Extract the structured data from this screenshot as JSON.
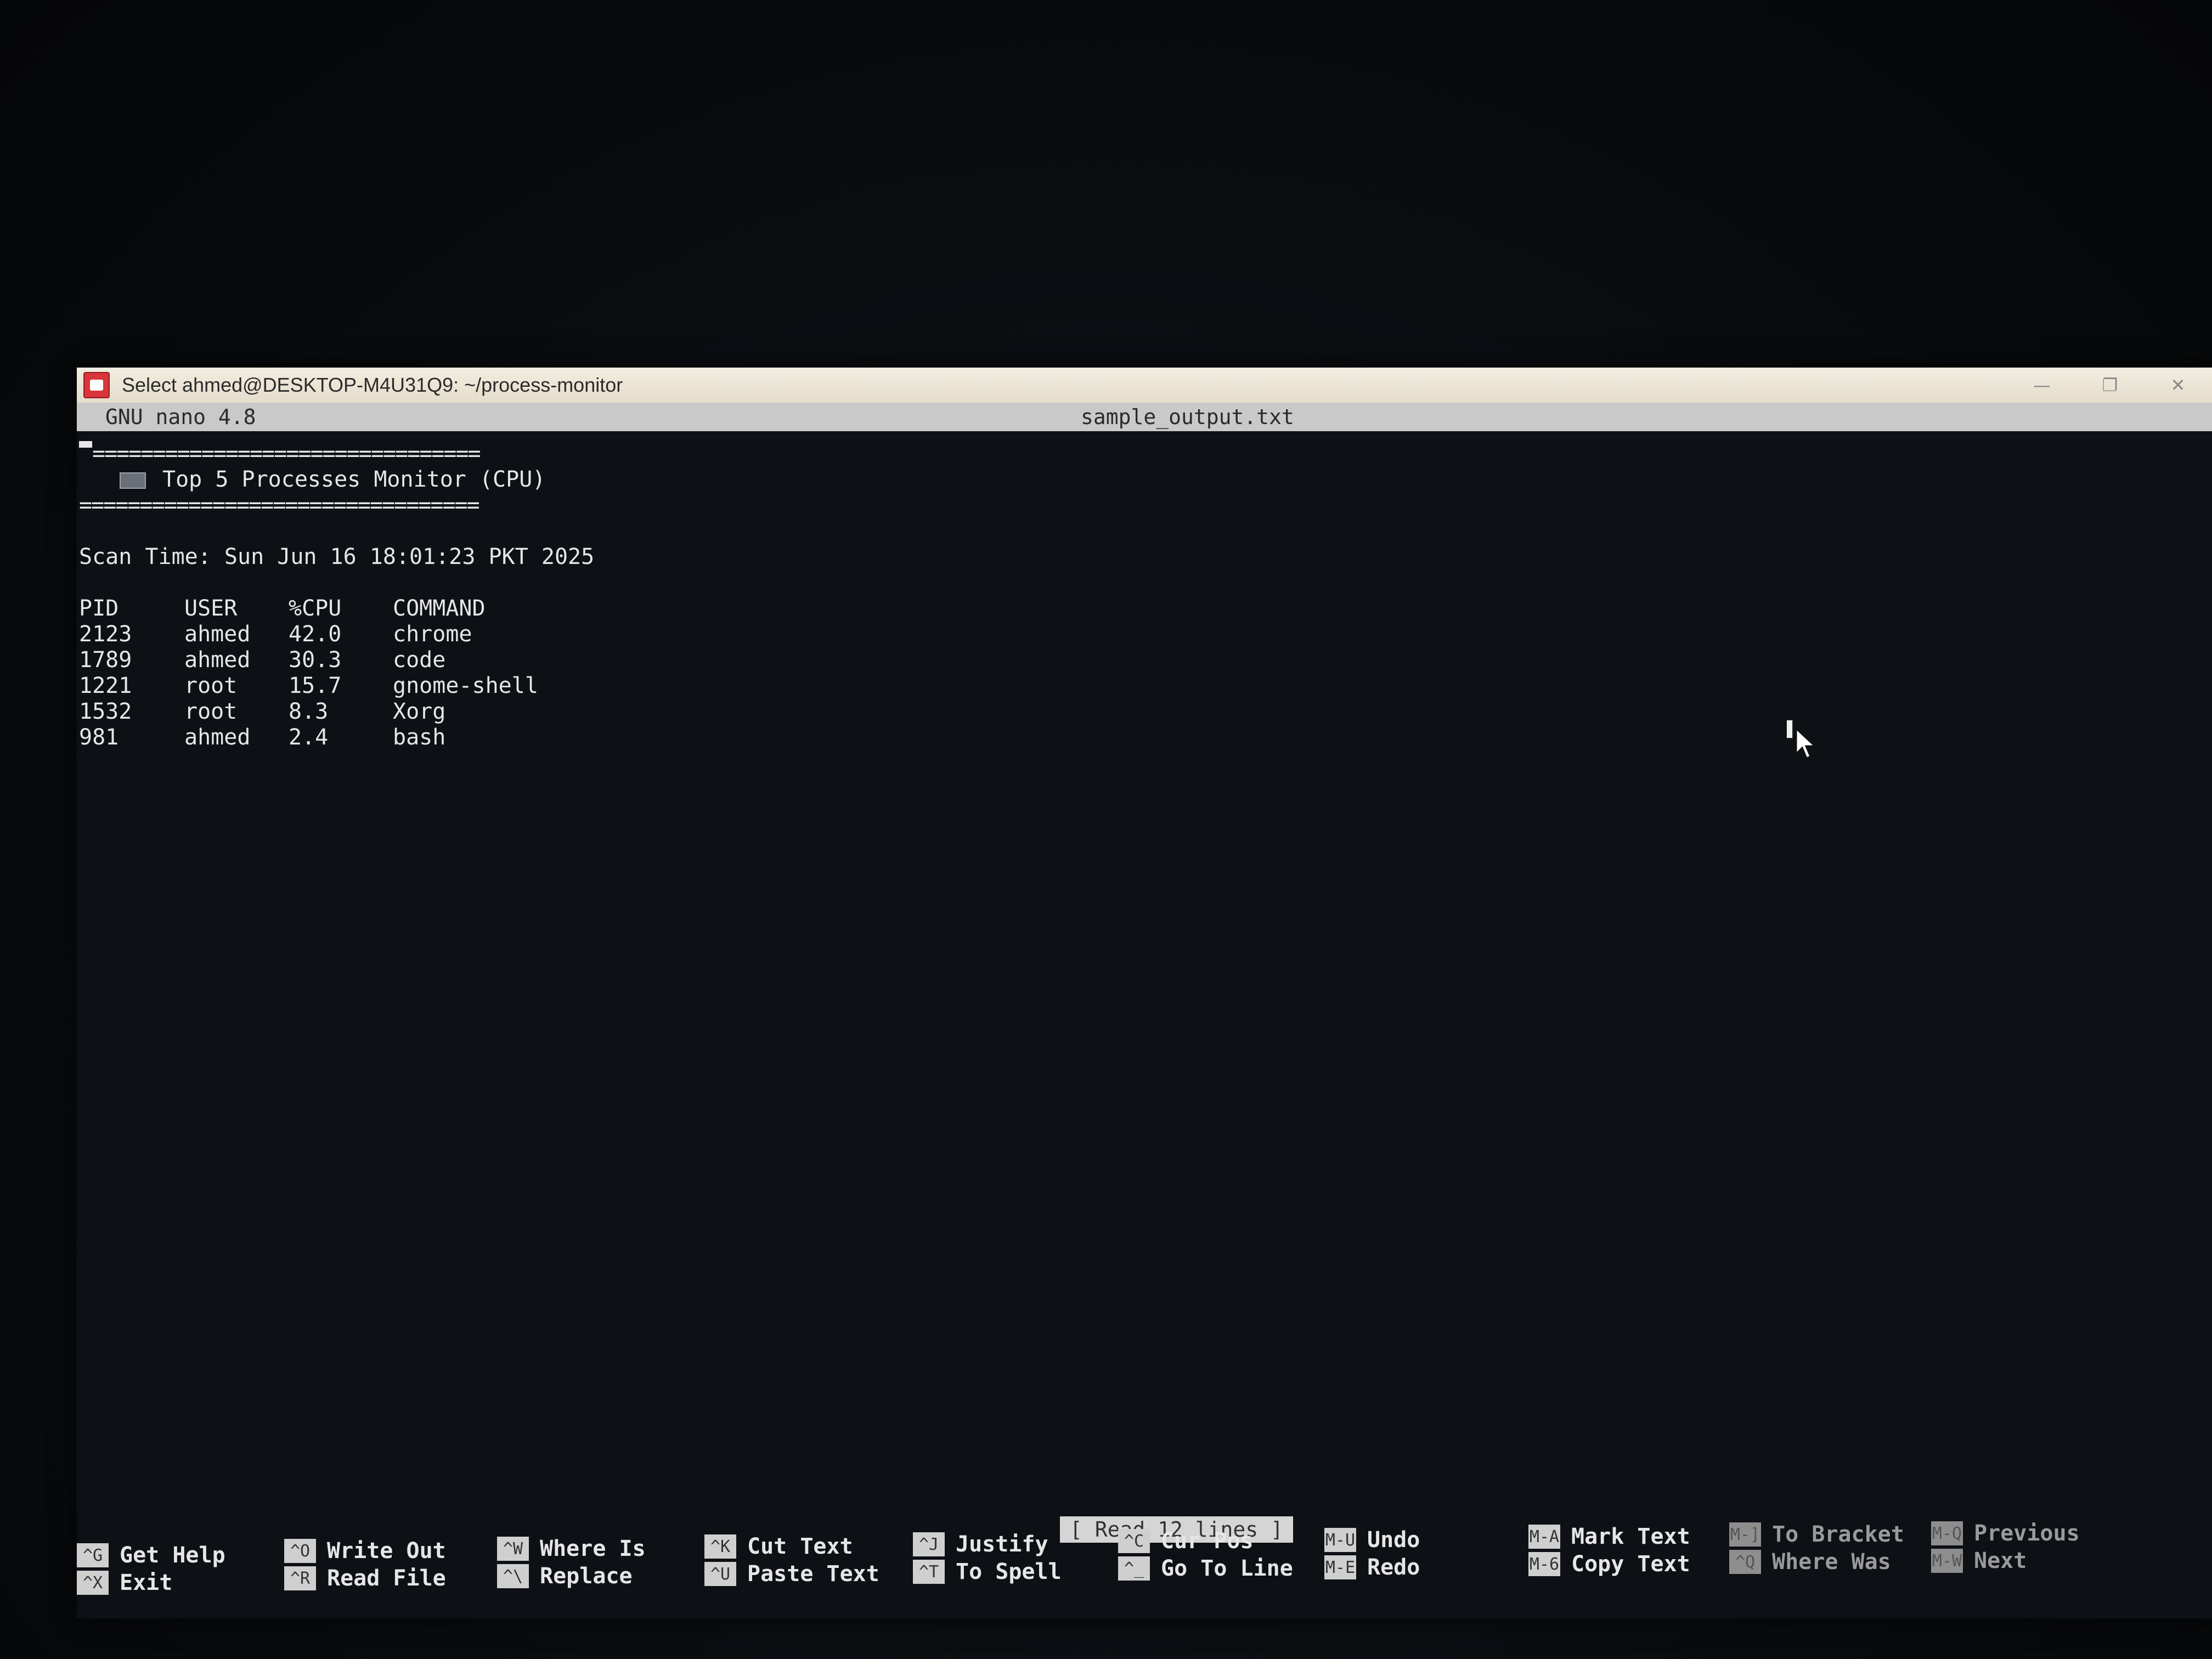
{
  "window": {
    "title": "Select ahmed@DESKTOP-M4U31Q9: ~/process-monitor",
    "controls": {
      "minimize": "—",
      "maximize": "❐",
      "close": "✕"
    }
  },
  "nano": {
    "version": "GNU nano 4.8",
    "filename": "sample_output.txt"
  },
  "file": {
    "rule": "=================================",
    "heading": "Top 5 Processes Monitor (CPU)",
    "scan_time": "Scan Time: Sun Jun 16 18:01:23 PKT 2025",
    "columns": [
      "PID",
      "USER",
      "%CPU",
      "COMMAND"
    ],
    "rows": [
      [
        "2123",
        "ahmed",
        "42.0",
        "chrome"
      ],
      [
        "1789",
        "ahmed",
        "30.3",
        "code"
      ],
      [
        "1221",
        "root",
        "15.7",
        "gnome-shell"
      ],
      [
        "1532",
        "root",
        "8.3",
        "Xorg"
      ],
      [
        "981",
        "ahmed",
        "2.4",
        "bash"
      ]
    ]
  },
  "status": "[ Read 12 lines ]",
  "shortcuts": [
    {
      "key": "^G",
      "label": "Get Help"
    },
    {
      "key": "^X",
      "label": "Exit"
    },
    {
      "key": "^O",
      "label": "Write Out"
    },
    {
      "key": "^R",
      "label": "Read File"
    },
    {
      "key": "^W",
      "label": "Where Is"
    },
    {
      "key": "^\\",
      "label": "Replace"
    },
    {
      "key": "^K",
      "label": "Cut Text"
    },
    {
      "key": "^U",
      "label": "Paste Text"
    },
    {
      "key": "^J",
      "label": "Justify"
    },
    {
      "key": "^T",
      "label": "To Spell"
    },
    {
      "key": "^C",
      "label": "Cur Pos"
    },
    {
      "key": "^_",
      "label": "Go To Line"
    },
    {
      "key": "M-U",
      "label": "Undo"
    },
    {
      "key": "M-E",
      "label": "Redo"
    },
    {
      "key": "M-A",
      "label": "Mark Text"
    },
    {
      "key": "M-6",
      "label": "Copy Text"
    },
    {
      "key": "M-]",
      "label": "To Bracket"
    },
    {
      "key": "^Q",
      "label": "Where Was"
    },
    {
      "key": "M-Q",
      "label": "Previous"
    },
    {
      "key": "M-W",
      "label": "Next"
    }
  ]
}
